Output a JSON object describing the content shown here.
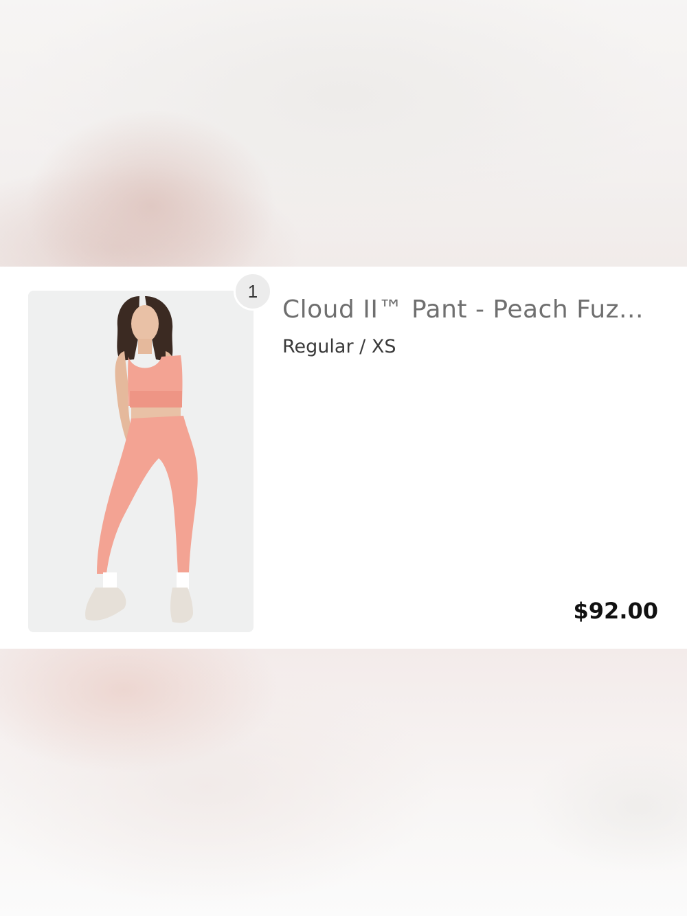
{
  "line_item": {
    "quantity": "1",
    "title": "Cloud II™ Pant - Peach Fuz...",
    "variant": "Regular / XS",
    "price": "$92.00",
    "image_icon": "product-photo-leggings",
    "colors": {
      "product": "#f3a393",
      "background": "#eff0f0",
      "price_text": "#111111",
      "title_text": "#6f6f6f"
    }
  }
}
